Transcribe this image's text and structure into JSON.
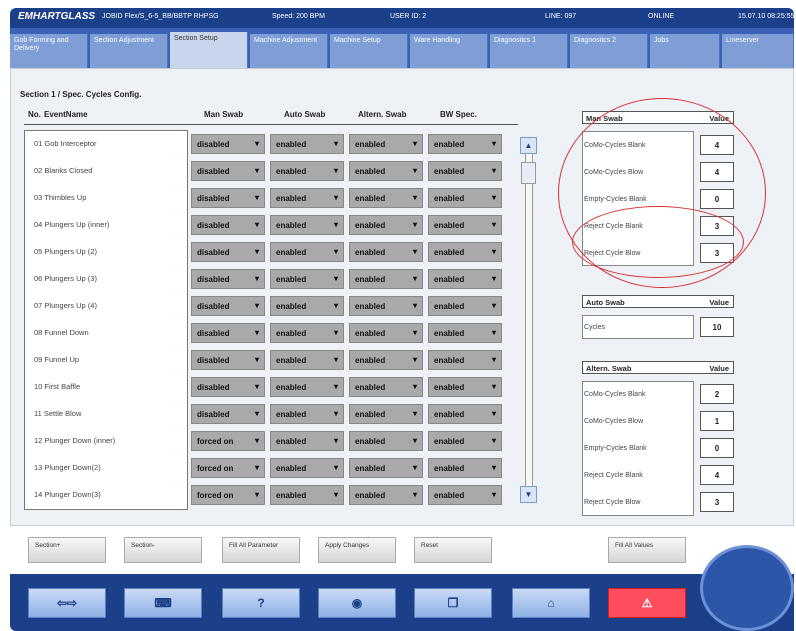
{
  "header": {
    "logo": "EMHARTGLASS",
    "job": "JOBID Flex/S_6-5_BB/BBTP RHPSG",
    "speed": "Speed: 200 BPM",
    "user": "USER ID: 2",
    "line": "LINE: 097",
    "status": "ONLINE",
    "datetime": "15.07.10 08:25:55"
  },
  "tabs": [
    {
      "label": "Gob Forming and Delivery"
    },
    {
      "label": "Section Adjustment"
    },
    {
      "label": "Section Setup"
    },
    {
      "label": "Machine Adjustment"
    },
    {
      "label": "Machine Setup"
    },
    {
      "label": "Ware Handling"
    },
    {
      "label": "Diagnostics 1"
    },
    {
      "label": "Diagnostics 2"
    },
    {
      "label": "Jobs"
    },
    {
      "label": "Lineserver"
    }
  ],
  "section_title": "Section 1 / Spec. Cycles Config.",
  "columns": {
    "no": "No.",
    "event": "EventName",
    "man": "Man Swab",
    "auto": "Auto Swab",
    "altern": "Altern. Swab",
    "bw": "BW Spec."
  },
  "rows": [
    {
      "label": "01  Gob Interceptor",
      "man": "disabled",
      "auto": "enabled",
      "altern": "enabled",
      "bw": "enabled"
    },
    {
      "label": "02  Blanks Closed",
      "man": "disabled",
      "auto": "enabled",
      "altern": "enabled",
      "bw": "enabled"
    },
    {
      "label": "03  Thimbles Up",
      "man": "disabled",
      "auto": "enabled",
      "altern": "enabled",
      "bw": "enabled"
    },
    {
      "label": "04  Plungers Up (inner)",
      "man": "disabled",
      "auto": "enabled",
      "altern": "enabled",
      "bw": "enabled"
    },
    {
      "label": "05  Plungers Up (2)",
      "man": "disabled",
      "auto": "enabled",
      "altern": "enabled",
      "bw": "enabled"
    },
    {
      "label": "06  Plungers Up (3)",
      "man": "disabled",
      "auto": "enabled",
      "altern": "enabled",
      "bw": "enabled"
    },
    {
      "label": "07  Plungers Up (4)",
      "man": "disabled",
      "auto": "enabled",
      "altern": "enabled",
      "bw": "enabled"
    },
    {
      "label": "08  Funnel Down",
      "man": "disabled",
      "auto": "enabled",
      "altern": "enabled",
      "bw": "enabled"
    },
    {
      "label": "09  Funnel Up",
      "man": "disabled",
      "auto": "enabled",
      "altern": "enabled",
      "bw": "enabled"
    },
    {
      "label": "10  First Baffle",
      "man": "disabled",
      "auto": "enabled",
      "altern": "enabled",
      "bw": "enabled"
    },
    {
      "label": "11  Settle Blow",
      "man": "disabled",
      "auto": "enabled",
      "altern": "enabled",
      "bw": "enabled"
    },
    {
      "label": "12  Plunger Down (inner)",
      "man": "forced on",
      "auto": "enabled",
      "altern": "enabled",
      "bw": "enabled"
    },
    {
      "label": "13  Plunger Down(2)",
      "man": "forced on",
      "auto": "enabled",
      "altern": "enabled",
      "bw": "enabled"
    },
    {
      "label": "14  Plunger Down(3)",
      "man": "forced on",
      "auto": "enabled",
      "altern": "enabled",
      "bw": "enabled"
    }
  ],
  "man_swab": {
    "title": "Man Swab",
    "value_header": "Value",
    "items": [
      {
        "label": "CoMo-Cycles Blank",
        "value": "4"
      },
      {
        "label": "CoMo-Cycles Blow",
        "value": "4"
      },
      {
        "label": "Empty-Cycles Blank",
        "value": "0"
      },
      {
        "label": "Reject Cycle Blank",
        "value": "3"
      },
      {
        "label": "Reject Cycle Blow",
        "value": "3"
      }
    ]
  },
  "auto_swab": {
    "title": "Auto Swab",
    "value_header": "Value",
    "items": [
      {
        "label": "Cycles",
        "value": "10"
      }
    ]
  },
  "altern_swab": {
    "title": "Altern. Swab",
    "value_header": "Value",
    "items": [
      {
        "label": "CoMo-Cycles Blank",
        "value": "2"
      },
      {
        "label": "CoMo-Cycles Blow",
        "value": "1"
      },
      {
        "label": "Empty-Cycles Blank",
        "value": "0"
      },
      {
        "label": "Reject Cycle Blank",
        "value": "4"
      },
      {
        "label": "Reject Cycle Blow",
        "value": "3"
      }
    ]
  },
  "buttons": {
    "section_plus": "Section+",
    "section_minus": "Section-",
    "fill_all_parameter": "Fill All Parameter",
    "apply_changes": "Apply Changes",
    "reset": "Reset",
    "fill_all_values": "Fill All Values"
  },
  "bottom_nav": {
    "arrows": "⇦⇨",
    "help": "?",
    "alarm": "⚠",
    "home": "⌂"
  },
  "colors": {
    "brand": "#1c3f8a",
    "highlight": "#d83232",
    "alarm": "#ff4d5e"
  }
}
